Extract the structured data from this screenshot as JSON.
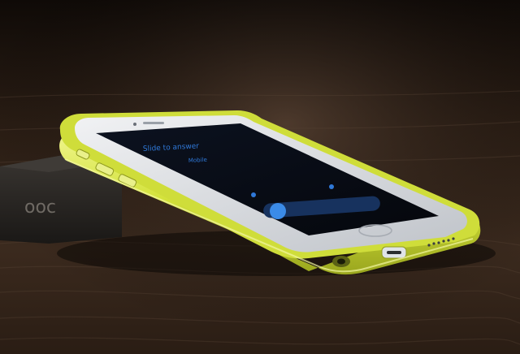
{
  "scene": {
    "description_free": true,
    "colors": {
      "table_dark": "#160f0a",
      "table_mid": "#3a2a1e",
      "table_light": "#5b4636",
      "bumper_yellow": "#d6e43a",
      "bumper_highlight": "#f2f7a0",
      "bumper_shadow": "#8f9a1f",
      "phone_silver": "#d9dbe0",
      "screen_black": "#070a12",
      "screen_blue": "#2f78d8",
      "box_dark": "#2b2825"
    },
    "screen": {
      "line1": "Slide to answer",
      "line2": "Mobile"
    },
    "box_label": "ooc"
  }
}
